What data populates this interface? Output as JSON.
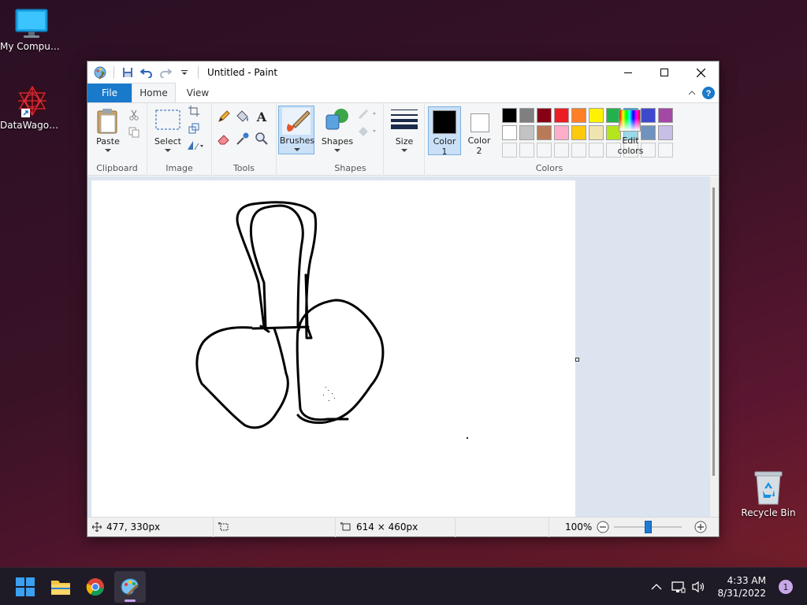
{
  "desktop": {
    "icons": [
      {
        "label": "My Computer"
      },
      {
        "label": "DataWagon..."
      },
      {
        "label": "Recycle Bin"
      }
    ]
  },
  "window": {
    "title": "Untitled - Paint",
    "tabs": {
      "file": "File",
      "home": "Home",
      "view": "View"
    },
    "ribbon": {
      "clipboard": {
        "paste": "Paste",
        "group": "Clipboard"
      },
      "image": {
        "select": "Select",
        "group": "Image"
      },
      "tools": {
        "group": "Tools"
      },
      "brushes": {
        "label": "Brushes"
      },
      "shapes": {
        "label": "Shapes",
        "group": "Shapes"
      },
      "size": {
        "label": "Size"
      },
      "color1": {
        "line1": "Color",
        "line2": "1",
        "value": "#000000"
      },
      "color2": {
        "line1": "Color",
        "line2": "2",
        "value": "#ffffff"
      },
      "colors": {
        "group": "Colors"
      },
      "edit_colors": {
        "line1": "Edit",
        "line2": "colors"
      },
      "palette_row1": [
        "#000000",
        "#7f7f7f",
        "#880015",
        "#ed1c24",
        "#ff7f27",
        "#fff200",
        "#22b14c",
        "#00a2e8",
        "#3f48cc",
        "#a349a4"
      ],
      "palette_row2": [
        "#ffffff",
        "#c3c3c3",
        "#b97a57",
        "#ffaec9",
        "#ffc90e",
        "#efe4b0",
        "#b5e61d",
        "#99d9ea",
        "#7092be",
        "#c8bfe7"
      ]
    },
    "status": {
      "cursor_pos": "477, 330px",
      "selection_size": "",
      "canvas_size": "614 × 460px",
      "zoom": "100%",
      "zoom_level": 0.5
    }
  },
  "taskbar": {
    "time": "4:33 AM",
    "date": "8/31/2022",
    "notification_count": "1"
  }
}
